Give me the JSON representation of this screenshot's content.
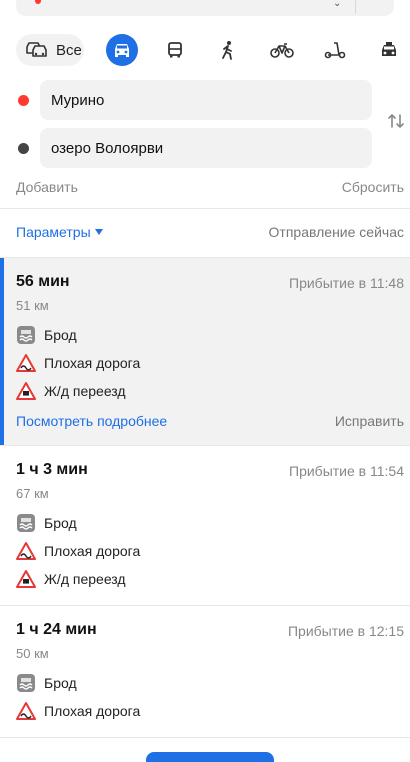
{
  "modes": {
    "all_label": "Все",
    "items": [
      "car-icon",
      "bus-icon",
      "walk-icon",
      "bike-icon",
      "scooter-icon",
      "taxi-icon"
    ],
    "active": "car-icon"
  },
  "waypoints": {
    "from": "Мурино",
    "to": "озеро Волоярви"
  },
  "actions": {
    "add": "Добавить",
    "reset": "Сбросить"
  },
  "options": {
    "params": "Параметры",
    "departure": "Отправление сейчас"
  },
  "routes": [
    {
      "time": "56 мин",
      "arrival": "Прибытие в 11:48",
      "distance": "51 км",
      "features": [
        "Брод",
        "Плохая дорога",
        "Ж/д переезд"
      ],
      "more": "Посмотреть подробнее",
      "fix": "Исправить"
    },
    {
      "time": "1 ч 3 мин",
      "arrival": "Прибытие в 11:54",
      "distance": "67 км",
      "features": [
        "Брод",
        "Плохая дорога",
        "Ж/д переезд"
      ]
    },
    {
      "time": "1 ч 24 мин",
      "arrival": "Прибытие в 12:15",
      "distance": "50 км",
      "features": [
        "Брод",
        "Плохая дорога"
      ]
    }
  ],
  "colors": {
    "accent": "#1f6fe5",
    "from_dot": "#ff3b30",
    "to_dot": "#444444",
    "warning": "#e53935"
  }
}
